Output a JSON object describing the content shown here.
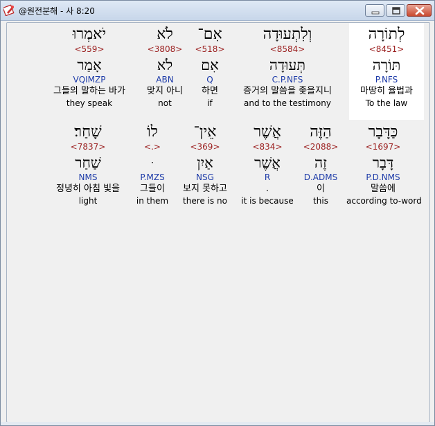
{
  "window": {
    "title": "@원전분해 - 사 8:20",
    "buttons": {
      "minimize": "minimize-button",
      "maximize": "maximize-button",
      "close": "close-button"
    }
  },
  "rows": [
    {
      "words": [
        {
          "hebrew": "יֹאמְרוּ",
          "strong": "<559>",
          "lemma": "אָמַר",
          "morph": "VQIMZP",
          "korean": "그들의 말하는 바가",
          "english": "they speak"
        },
        {
          "hebrew": "לֹא",
          "strong": "<3808>",
          "lemma": "לֹא",
          "morph": "ABN",
          "korean": "맞지 아니",
          "english": "not"
        },
        {
          "hebrew": "אִם־",
          "strong": "<518>",
          "lemma": "אִם",
          "morph": "Q",
          "korean": "하면",
          "english": "if"
        },
        {
          "hebrew": "וְלִתְעוּדָה",
          "strong": "<8584>",
          "lemma": "תְּעוּדָה",
          "morph": "C.P.NFS",
          "korean": "증거의 말씀을 좇을지니",
          "english": "and to the testimony"
        },
        {
          "hebrew": "לְתוֹרָה",
          "strong": "<8451>",
          "lemma": "תּוֹרָה",
          "morph": "P.NFS",
          "korean": "마땅히 율법과",
          "english": "To the law"
        }
      ]
    },
    {
      "words": [
        {
          "hebrew": "שָׁחַר׃",
          "strong": "<7837>",
          "lemma": "שַׁחַר",
          "morph": "NMS",
          "korean": "정녕히 아침 빛을",
          "english": "light"
        },
        {
          "hebrew": "לוֹ",
          "strong": "<.>",
          "lemma": "ּ",
          "morph": "P.MZS",
          "korean": "그들이",
          "english": "in them"
        },
        {
          "hebrew": "אֵין־",
          "strong": "<369>",
          "lemma": "אַיִן",
          "morph": "NSG",
          "korean": "보지 못하고",
          "english": "there is no"
        },
        {
          "hebrew": "אֲשֶׁר",
          "strong": "<834>",
          "lemma": "אֲשֶׁר",
          "morph": "R",
          "korean": ".",
          "english": "it is because"
        },
        {
          "hebrew": "הַזֶּה",
          "strong": "<2088>",
          "lemma": "זֶה",
          "morph": "D.ADMS",
          "korean": "이",
          "english": "this"
        },
        {
          "hebrew": "כַּדָּבָר",
          "strong": "<1697>",
          "lemma": "דָּבָר",
          "morph": "P.D.NMS",
          "korean": "말씀에",
          "english": "according to-word"
        }
      ]
    }
  ]
}
